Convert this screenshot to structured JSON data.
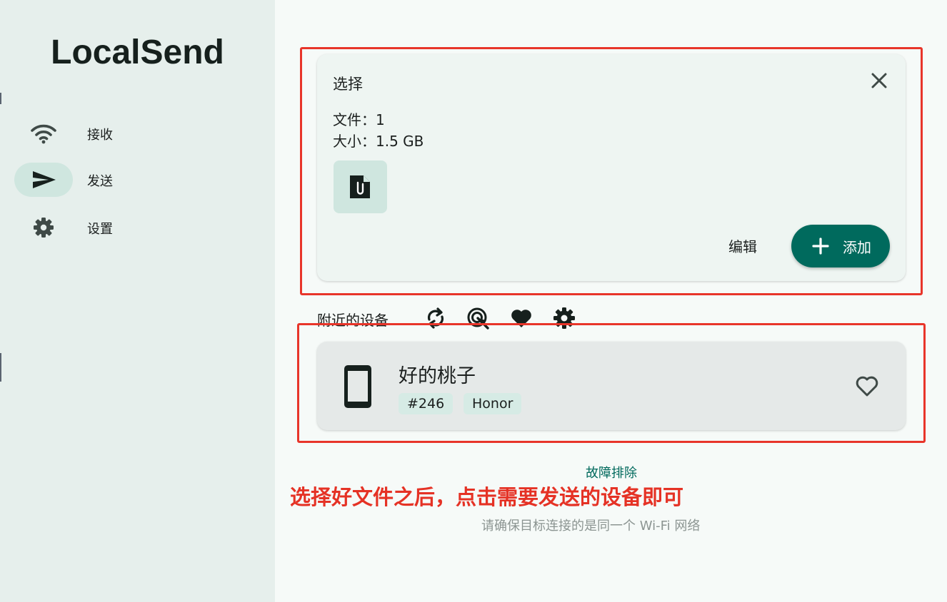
{
  "app": {
    "title": "LocalSend"
  },
  "sidebar": {
    "items": [
      {
        "label": "接收",
        "icon": "wifi-icon",
        "active": false
      },
      {
        "label": "发送",
        "icon": "send-icon",
        "active": true
      },
      {
        "label": "设置",
        "icon": "gear-icon",
        "active": false
      }
    ]
  },
  "selection": {
    "title": "选择",
    "files_line": "文件：1",
    "size_line": "大小：1.5 GB",
    "file_icon": "attachment-file-icon",
    "edit_label": "编辑",
    "add_label": "添加"
  },
  "nearby": {
    "label": "附近的设备",
    "tools": [
      "refresh-icon",
      "scan-target-icon",
      "favorites-heart-icon",
      "settings-gear-icon"
    ],
    "devices": [
      {
        "name": "好的桃子",
        "tag": "#246",
        "brand": "Honor",
        "icon": "tablet-icon"
      }
    ]
  },
  "troubleshoot_label": "故障排除",
  "annotation_text": "选择好文件之后，点击需要发送的设备即可",
  "hint_text": "请确保目标连接的是同一个 Wi-Fi 网络",
  "colors": {
    "accent": "#006a5d",
    "sidebar_bg": "#e6efec",
    "annotation_red": "#e53225"
  }
}
